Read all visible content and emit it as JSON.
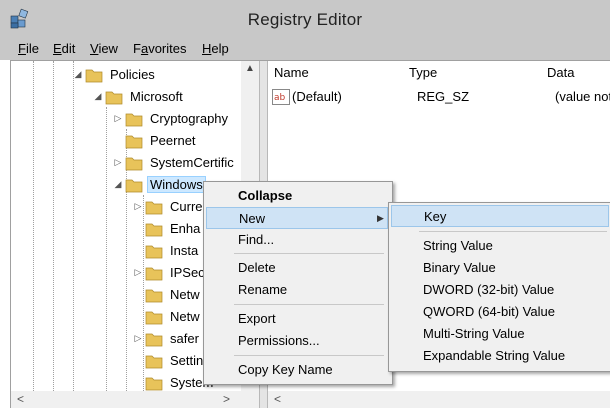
{
  "window": {
    "title": "Registry Editor"
  },
  "menubar": [
    {
      "key": "F",
      "rest": "ile"
    },
    {
      "key": "E",
      "rest": "dit"
    },
    {
      "key": "V",
      "rest": "iew"
    },
    {
      "key": "a",
      "pre": "F",
      "rest": "vorites"
    },
    {
      "key": "H",
      "rest": "elp"
    }
  ],
  "tree": {
    "policies": "Policies",
    "microsoft": "Microsoft",
    "cryptography": "Cryptography",
    "peernet": "Peernet",
    "systemcert": "SystemCertific",
    "windows": "Windows",
    "children": [
      "Curre",
      "Enha",
      "Insta",
      "IPSec",
      "Netw",
      "Netw",
      "safer",
      "Settin",
      "System"
    ]
  },
  "values_pane": {
    "columns": [
      "Name",
      "Type",
      "Data"
    ],
    "rows": [
      {
        "name": "(Default)",
        "type": "REG_SZ",
        "data": "(value not"
      }
    ]
  },
  "context_menu": {
    "items": [
      "Collapse",
      "New",
      "Find...",
      "Delete",
      "Rename",
      "Export",
      "Permissions...",
      "Copy Key Name"
    ]
  },
  "new_submenu": {
    "items": [
      "Key",
      "String Value",
      "Binary Value",
      "DWORD (32-bit) Value",
      "QWORD (64-bit) Value",
      "Multi-String Value",
      "Expandable String Value"
    ]
  },
  "colors": {
    "folder": "#e8c35a",
    "selection": "#cde8ff",
    "menu_highlight": "#cfe3f5"
  }
}
